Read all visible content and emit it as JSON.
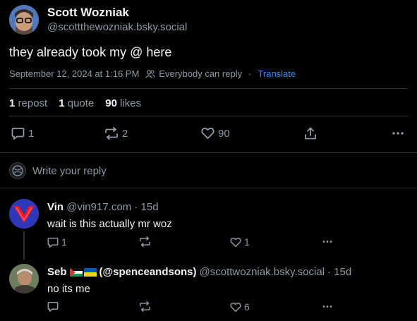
{
  "post": {
    "author_name": "Scott Wozniak",
    "author_handle": "@scottthewozniak.bsky.social",
    "text": "they already took my @ here",
    "timestamp": "September 12, 2024 at 1:16 PM",
    "reply_setting": "Everybody can reply",
    "separator": "·",
    "translate": "Translate",
    "stats": {
      "reposts_count": "1",
      "reposts_label": "repost",
      "quotes_count": "1",
      "quotes_label": "quote",
      "likes_count": "90",
      "likes_label": "likes"
    },
    "actions": {
      "reply_count": "1",
      "repost_count": "2",
      "like_count": "90"
    }
  },
  "composer": {
    "placeholder": "Write your reply"
  },
  "replies": [
    {
      "name": "Vin",
      "handle": "@vin917.com",
      "age": "· 15d",
      "text": "wait is this actually mr woz",
      "reply_count": "1",
      "like_count": "1"
    },
    {
      "name": "Seb",
      "display_rest": "(@spenceandsons)",
      "handle": "@scottwozniak.bsky.social",
      "age": "· 15d",
      "text": "no its me",
      "like_count": "6"
    }
  ],
  "colors": {
    "accent": "#2a8ff7",
    "muted": "#8d99a6",
    "background": "#000000",
    "divider": "#2e3439"
  },
  "icons": [
    "author-avatar",
    "people-icon",
    "reply-icon",
    "repost-icon",
    "heart-icon",
    "share-icon",
    "more-icon",
    "user-avatar",
    "flag-icons"
  ]
}
